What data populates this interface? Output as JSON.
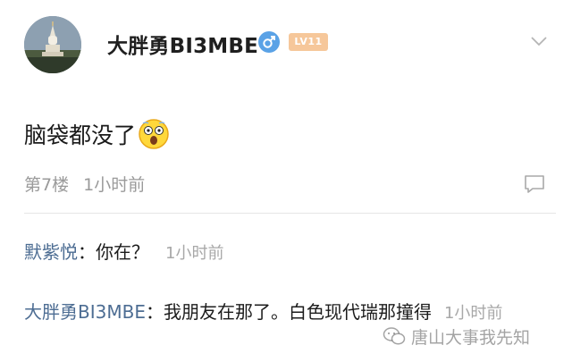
{
  "post": {
    "username": "大胖勇BI3MBE",
    "level": "LV11",
    "content": "脑袋都没了",
    "floor": "第7楼",
    "time": "1小时前"
  },
  "icons": {
    "avatar": "pagoda-photo",
    "gender": "male-icon",
    "emoji": "shocked-face-emoji",
    "more": "chevron-down-icon",
    "comment": "comment-icon",
    "watermark": "wechat-icon"
  },
  "replies": [
    {
      "author": "默紫悦",
      "separator": "：",
      "text": "你在？",
      "time": "1小时前"
    },
    {
      "author": "大胖勇BI3MBE",
      "separator": "：",
      "text": "我朋友在那了。白色现代瑞那撞得",
      "time": "1小时前"
    }
  ],
  "watermark": {
    "text": "唐山大事我先知"
  },
  "colors": {
    "author_link": "#4d6d93",
    "meta_gray": "#9a9a9a",
    "gender_blue": "#5aa2e6",
    "level_badge": "#f6c79a"
  }
}
